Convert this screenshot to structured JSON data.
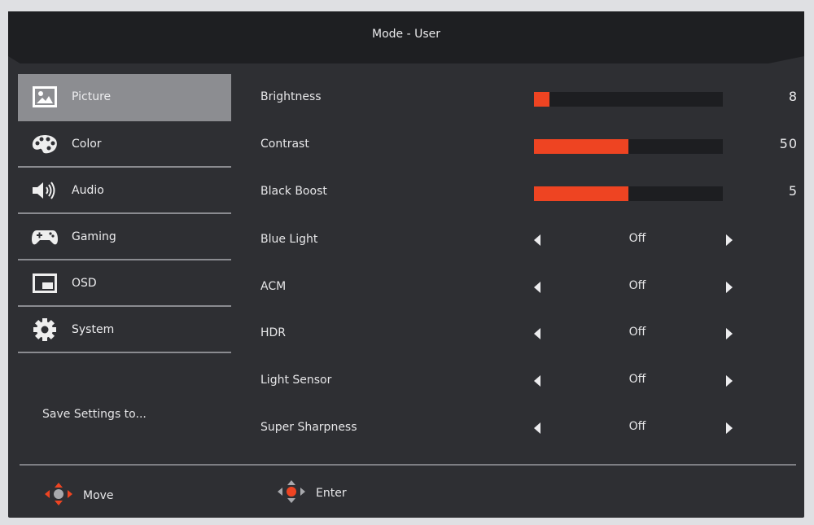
{
  "header": {
    "title": "Mode - User"
  },
  "sidebar": {
    "items": [
      {
        "label": "Picture",
        "icon": "picture-icon",
        "active": true
      },
      {
        "label": "Color",
        "icon": "palette-icon"
      },
      {
        "label": "Audio",
        "icon": "speaker-icon"
      },
      {
        "label": "Gaming",
        "icon": "gamepad-icon"
      },
      {
        "label": "OSD",
        "icon": "osd-window-icon"
      },
      {
        "label": "System",
        "icon": "gear-icon"
      }
    ],
    "save_settings": "Save Settings to..."
  },
  "settings": {
    "sliders": [
      {
        "label": "Brightness",
        "value": "8",
        "fill_fraction": 0.08
      },
      {
        "label": "Contrast",
        "value": "50",
        "fill_fraction": 0.5
      },
      {
        "label": "Black Boost",
        "value": "5",
        "fill_fraction": 0.5
      }
    ],
    "options": [
      {
        "label": "Blue Light",
        "value": "Off"
      },
      {
        "label": "ACM",
        "value": "Off"
      },
      {
        "label": "HDR",
        "value": "Off"
      },
      {
        "label": "Light Sensor",
        "value": "Off"
      },
      {
        "label": "Super Sharpness",
        "value": "Off"
      }
    ]
  },
  "footer": {
    "move_label": "Move",
    "enter_label": "Enter"
  },
  "colors": {
    "accent": "#ee4422",
    "panel": "#2e2f33",
    "active_item": "#8c8d91"
  }
}
